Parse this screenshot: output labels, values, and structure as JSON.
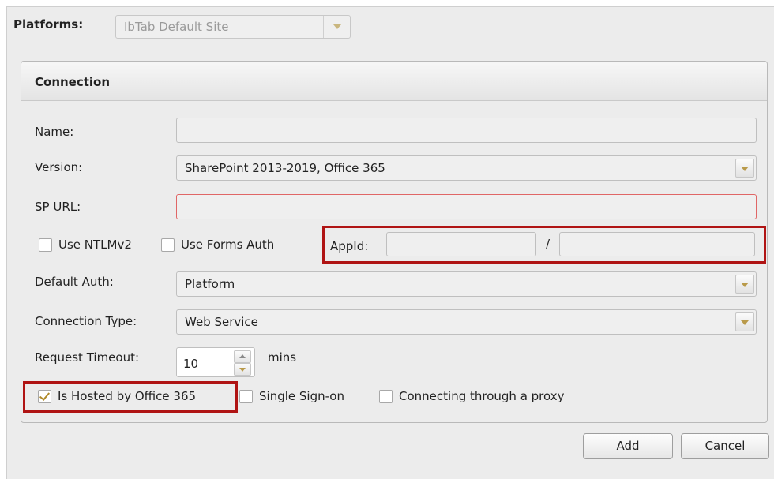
{
  "platforms": {
    "label": "Platforms:",
    "selected": "IbTab Default Site",
    "arrow_icon": "chevron-down-icon"
  },
  "connection": {
    "title": "Connection",
    "name": {
      "label": "Name:",
      "value": ""
    },
    "version": {
      "label": "Version:",
      "value": "SharePoint 2013-2019, Office 365"
    },
    "sp_url": {
      "label": "SP URL:",
      "value": ""
    },
    "use_ntlmv2": {
      "label": "Use NTLMv2",
      "checked": false
    },
    "use_forms_auth": {
      "label": "Use Forms Auth",
      "checked": false
    },
    "appid": {
      "label": "AppId:",
      "value1": "",
      "separator": "/",
      "value2": ""
    },
    "default_auth": {
      "label": "Default Auth:",
      "value": "Platform"
    },
    "connection_type": {
      "label": "Connection Type:",
      "value": "Web Service"
    },
    "request_timeout": {
      "label": "Request Timeout:",
      "value": "10",
      "unit": "mins"
    },
    "is_hosted_o365": {
      "label": "Is Hosted by Office 365",
      "checked": true
    },
    "single_sign_on": {
      "label": "Single Sign-on",
      "checked": false
    },
    "through_proxy": {
      "label": "Connecting through a proxy",
      "checked": false
    }
  },
  "buttons": {
    "add": "Add",
    "cancel": "Cancel"
  },
  "colors": {
    "highlight": "#b01414",
    "error_border": "#e06666",
    "check_accent": "#b08a2a"
  }
}
